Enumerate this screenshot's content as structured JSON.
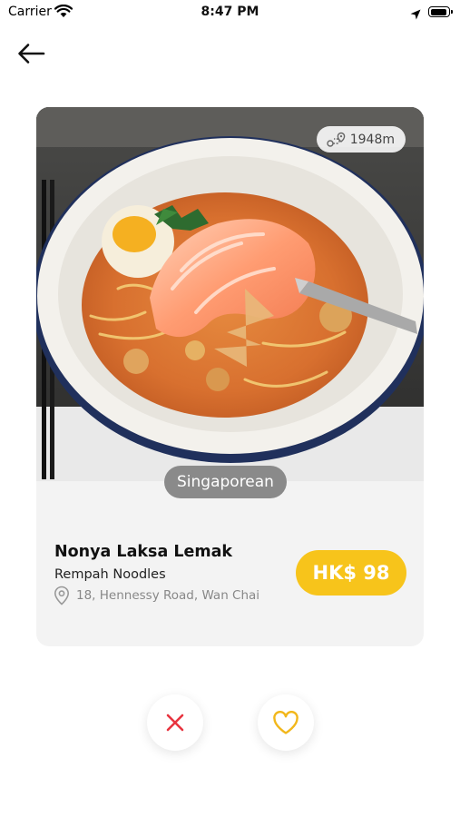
{
  "status_bar": {
    "carrier": "Carrier",
    "time": "8:47 PM"
  },
  "card": {
    "distance": "1948m",
    "cuisine": "Singaporean",
    "dish_name": "Nonya Laksa Lemak",
    "restaurant": "Rempah Noodles",
    "address": "18, Hennessy Road, Wan Chai",
    "price": "HK$ 98"
  },
  "icons": {
    "back": "arrow-left-icon",
    "location_pin": "location-pin-icon",
    "route": "route-icon",
    "dislike": "close-icon",
    "like": "heart-icon"
  },
  "colors": {
    "accent": "#F7C41B",
    "dislike": "#E8343F",
    "like": "#F2B71B",
    "card_background": "#F3F3F3",
    "tag_background": "#8A8A8A"
  }
}
